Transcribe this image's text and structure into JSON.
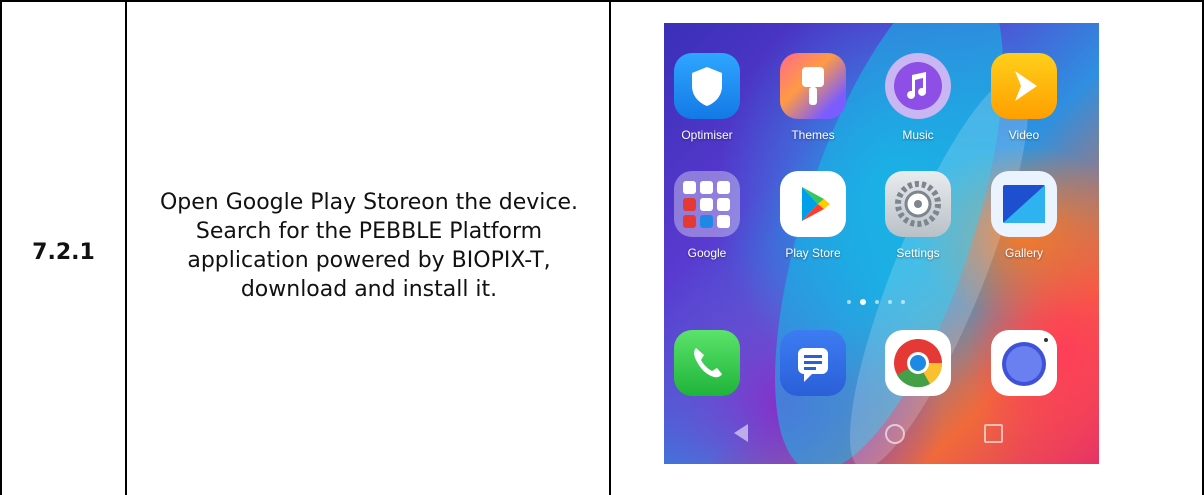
{
  "row": {
    "step_number": "7.2.1",
    "instruction_lines": [
      "Open Google Play Storeon the device.",
      "Search for the PEBBLE Platform",
      "application powered by BIOPIX-T,",
      "download and install it."
    ]
  },
  "phone": {
    "apps_row1": [
      {
        "label": "Optimiser",
        "icon": "shield-icon"
      },
      {
        "label": "Themes",
        "icon": "paintbrush-icon"
      },
      {
        "label": "Music",
        "icon": "music-note-icon"
      },
      {
        "label": "Video",
        "icon": "play-icon"
      }
    ],
    "apps_row2": [
      {
        "label": "Google",
        "icon": "google-folder-icon"
      },
      {
        "label": "Play Store",
        "icon": "play-store-icon"
      },
      {
        "label": "Settings",
        "icon": "gear-icon"
      },
      {
        "label": "Gallery",
        "icon": "gallery-icon"
      }
    ],
    "dock": [
      {
        "icon": "phone-icon"
      },
      {
        "icon": "messages-icon"
      },
      {
        "icon": "chrome-icon"
      },
      {
        "icon": "camera-icon"
      }
    ],
    "page_indicator": {
      "count": 5,
      "active": 1
    },
    "nav_buttons": [
      "back-icon",
      "home-icon",
      "recents-icon"
    ]
  }
}
